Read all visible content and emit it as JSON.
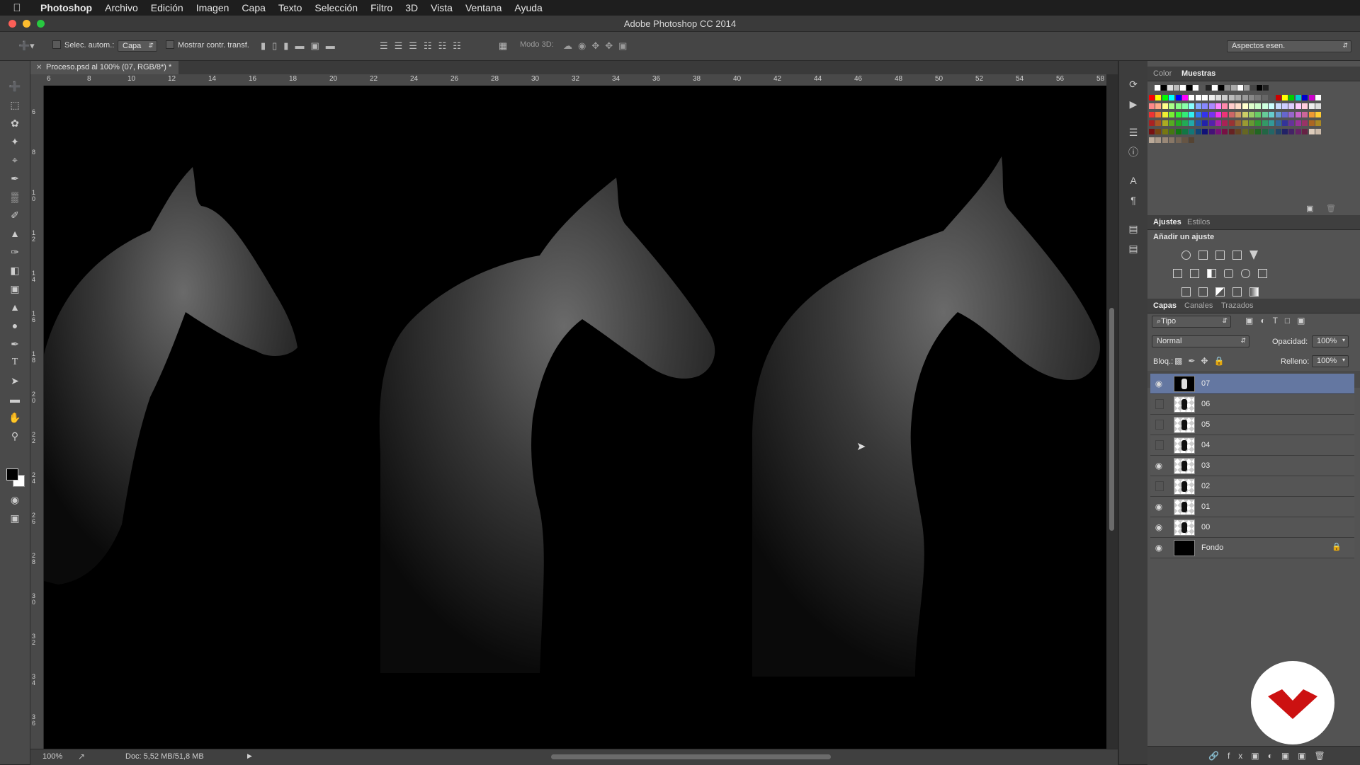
{
  "menubar": {
    "apple": "",
    "items": [
      "Photoshop",
      "Archivo",
      "Edición",
      "Imagen",
      "Capa",
      "Texto",
      "Selección",
      "Filtro",
      "3D",
      "Vista",
      "Ventana",
      "Ayuda"
    ]
  },
  "window": {
    "title": "Adobe Photoshop CC 2014"
  },
  "options_bar": {
    "auto_select_label": "Selec. autom.:",
    "auto_select_value": "Capa",
    "show_transform_label": "Mostrar contr. transf.",
    "mode3d_label": "Modo 3D:",
    "workspace_value": "Aspectos esen."
  },
  "document": {
    "tab_title": "Proceso.psd al 100% (07, RGB/8*) *",
    "zoom": "100%",
    "doc_info": "Doc: 5,52 MB/51,8 MB"
  },
  "rulers": {
    "top_labels": [
      "6",
      "8",
      "10",
      "12",
      "14",
      "16",
      "18",
      "20",
      "22",
      "24",
      "26",
      "28",
      "30",
      "32",
      "34",
      "36",
      "38",
      "40",
      "42",
      "44",
      "46",
      "48",
      "50",
      "52",
      "54",
      "56",
      "58"
    ],
    "left_labels": [
      "6",
      "8",
      "10",
      "12",
      "14",
      "16",
      "18",
      "20",
      "22",
      "24",
      "26",
      "28",
      "30",
      "32",
      "34",
      "36"
    ]
  },
  "color_panel": {
    "tabs": [
      "Color",
      "Muestras"
    ],
    "active": "Muestras"
  },
  "adjustments_panel": {
    "tabs": [
      "Ajustes",
      "Estilos"
    ],
    "active": "Ajustes",
    "heading": "Añadir un ajuste"
  },
  "layers_panel": {
    "tabs": [
      "Capas",
      "Canales",
      "Trazados"
    ],
    "active": "Capas",
    "filter_value": "Tipo",
    "blend_mode": "Normal",
    "opacity_label": "Opacidad:",
    "opacity_value": "100%",
    "lock_label": "Bloq.:",
    "fill_label": "Relleno:",
    "fill_value": "100%",
    "layers": [
      {
        "name": "07",
        "visible": true,
        "selected": true
      },
      {
        "name": "06",
        "visible": false,
        "selected": false
      },
      {
        "name": "05",
        "visible": false,
        "selected": false
      },
      {
        "name": "04",
        "visible": false,
        "selected": false
      },
      {
        "name": "03",
        "visible": true,
        "selected": false
      },
      {
        "name": "02",
        "visible": false,
        "selected": false
      },
      {
        "name": "01",
        "visible": true,
        "selected": false
      },
      {
        "name": "00",
        "visible": true,
        "selected": false
      },
      {
        "name": "Fondo",
        "visible": true,
        "selected": false,
        "locked": true
      }
    ]
  },
  "colors": {
    "selected_layer": "#6477a1",
    "brand_red": "#cc1111"
  }
}
